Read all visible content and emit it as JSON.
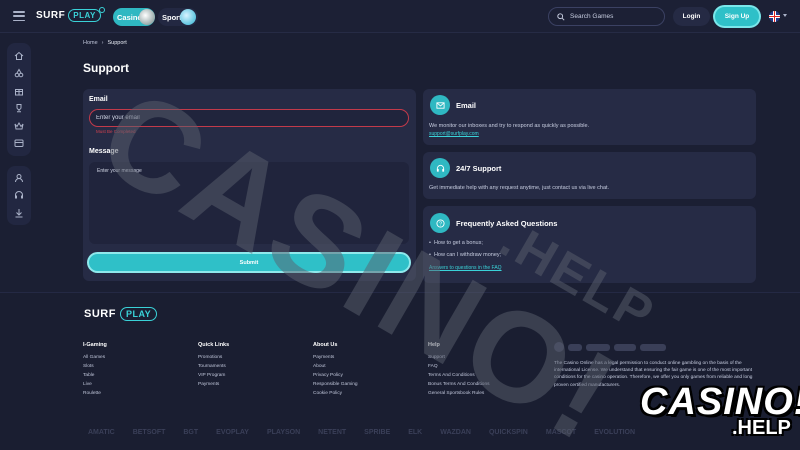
{
  "header": {
    "logo_main": "SURF",
    "logo_play": "PLAY",
    "casino_tab": "Casino",
    "sports_tab": "Sports",
    "search_placeholder": "Search Games",
    "login_label": "Login",
    "signup_label": "Sign Up",
    "language_flag": "uk-flag-icon"
  },
  "sidebar": {
    "group1_icons": [
      "home-icon",
      "slots-cherry-icon",
      "gift-icon",
      "trophy-icon",
      "crown-icon",
      "wallet-icon"
    ],
    "group2_icons": [
      "profile-icon",
      "headset-icon",
      "download-icon"
    ]
  },
  "breadcrumb": {
    "home": "Home",
    "current": "Support"
  },
  "page_title": "Support",
  "form": {
    "email_label": "Email",
    "email_placeholder": "Enter your email",
    "email_error": "Must Be Completed",
    "message_label": "Message",
    "message_placeholder": "Enter your message",
    "submit_label": "Submit"
  },
  "cards": {
    "email": {
      "title": "Email",
      "text": "We monitor our inboxes and try to respond as quickly as possible.",
      "link": "support@surfplay.com",
      "icon": "envelope-icon"
    },
    "support": {
      "title": "24/7 Support",
      "text": "Get immediate help with any request anytime, just contact us via live chat.",
      "icon": "headset-icon"
    },
    "faq": {
      "title": "Frequently Asked Questions",
      "items": [
        "How to get a bonus;",
        "How can I withdraw money;"
      ],
      "link": "Answers to questions in the FAQ",
      "icon": "question-icon"
    }
  },
  "footer": {
    "logo_main": "SURF",
    "logo_play": "PLAY",
    "columns": [
      {
        "title": "I-Gaming",
        "links": [
          "All Games",
          "Slots",
          "Table",
          "Live",
          "Roulette"
        ]
      },
      {
        "title": "Quick Links",
        "links": [
          "Promotions",
          "Tournaments",
          "VIP Program",
          "Payments"
        ]
      },
      {
        "title": "About Us",
        "links": [
          "Payments",
          "About",
          "Privacy Policy",
          "Responsible Gaming",
          "Cookie Policy"
        ]
      },
      {
        "title": "Help",
        "links": [
          "Support",
          "FAQ",
          "Terms And Conditions",
          "Bonus Terms And Conditions",
          "General Sportsbook Rules"
        ]
      }
    ],
    "legal_text": "The Casino Online has a legal permission to conduct online gambling on the basis of the international License. We understand that ensuring the fair game is one of the most important conditions for the casino operation. Therefore, we offer you only games from reliable and long proven certified manufacturers.",
    "providers": [
      "AMATIC",
      "BETSOFT",
      "BGT",
      "EVOPLAY",
      "PLAYSON",
      "NETENT",
      "SPRIBE",
      "ELK",
      "WAZDAN",
      "QUICKSPIN",
      "MASCOT",
      "EVOLUTION",
      "AMATIC",
      "BETSOFT",
      "BGT"
    ]
  },
  "watermark": {
    "big": "CASINO!",
    "small": ".HELP"
  },
  "colors": {
    "accent": "#2fc0c8",
    "background": "#1b1f33",
    "card": "#262b45",
    "error": "#d0414f"
  }
}
